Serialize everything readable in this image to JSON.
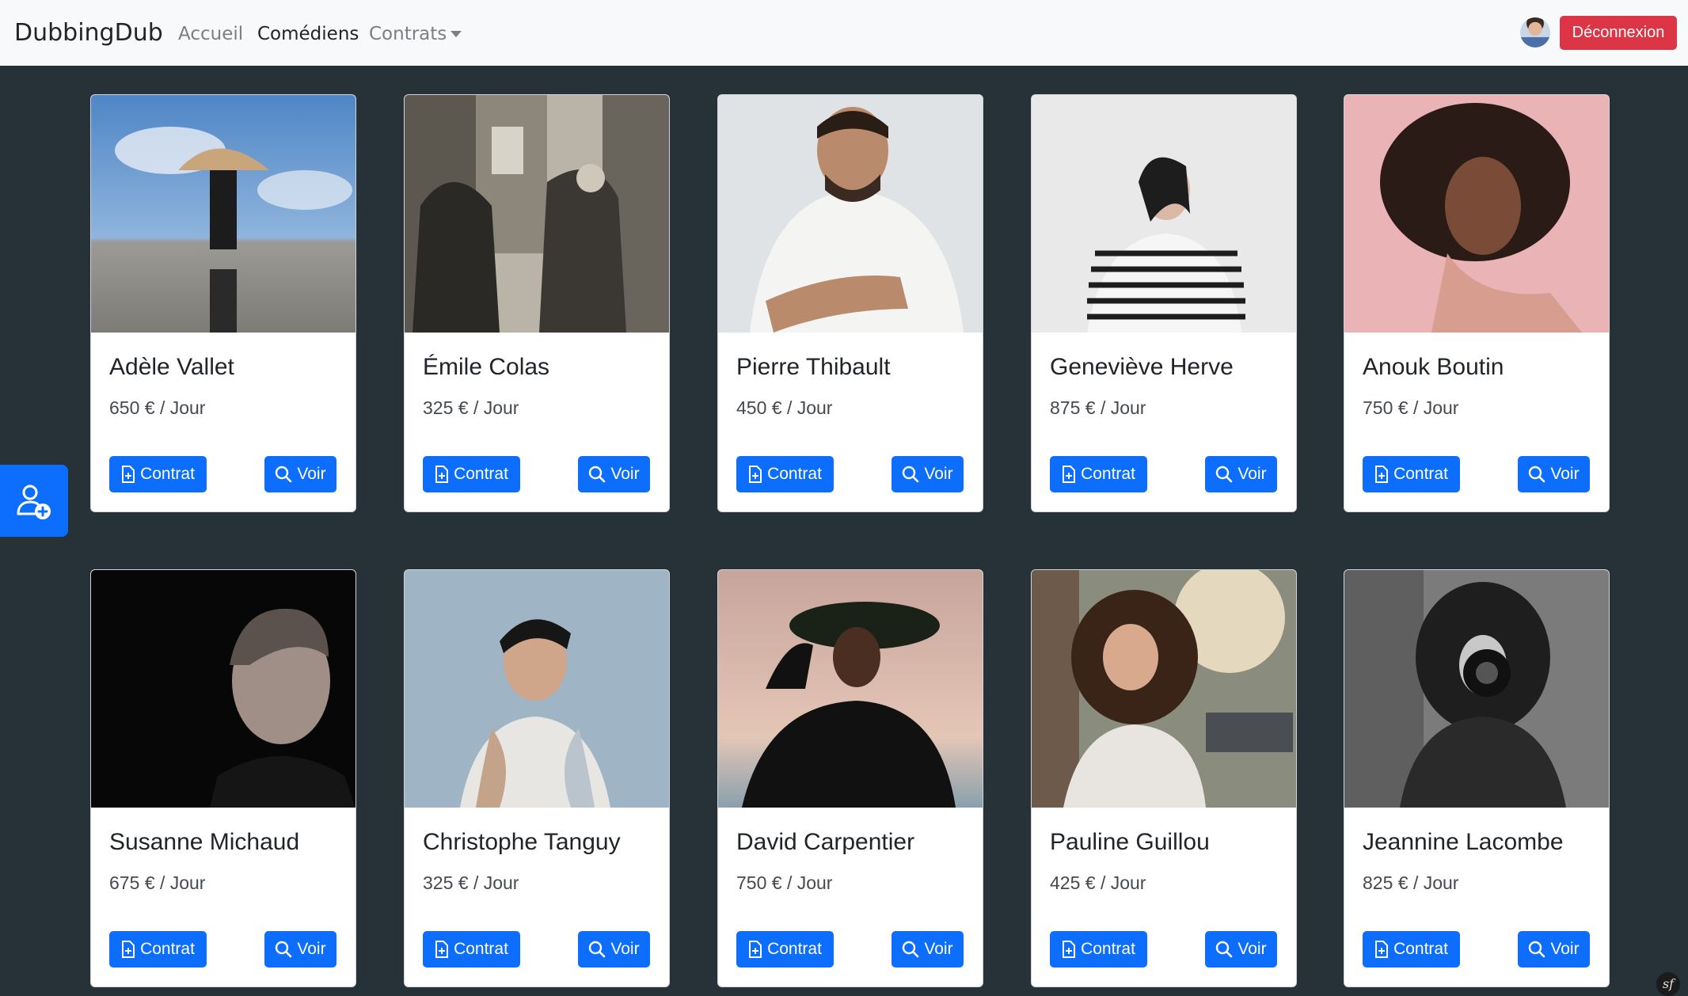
{
  "navbar": {
    "brand": "DubbingDub",
    "links": [
      {
        "label": "Accueil",
        "active": false
      },
      {
        "label": "Comédiens",
        "active": true
      },
      {
        "label": "Contrats",
        "active": false,
        "dropdown": true
      }
    ],
    "logout_label": "Déconnexion",
    "logout_color": "#dc3545"
  },
  "fab": {
    "icon": "user-add-icon"
  },
  "buttons": {
    "contract_label": "Contrat",
    "contract_icon": "file-plus-icon",
    "view_label": "Voir",
    "view_icon": "search-icon",
    "color": "#0d6efd"
  },
  "actors": [
    {
      "name": "Adèle Vallet",
      "price": "650 € / Jour"
    },
    {
      "name": "Émile Colas",
      "price": "325 € / Jour"
    },
    {
      "name": "Pierre Thibault",
      "price": "450 € / Jour"
    },
    {
      "name": "Geneviève Herve",
      "price": "875 € / Jour"
    },
    {
      "name": "Anouk Boutin",
      "price": "750 € / Jour"
    },
    {
      "name": "Susanne Michaud",
      "price": "675 € / Jour"
    },
    {
      "name": "Christophe Tanguy",
      "price": "325 € / Jour"
    },
    {
      "name": "David Carpentier",
      "price": "750 € / Jour"
    },
    {
      "name": "Pauline Guillou",
      "price": "425 € / Jour"
    },
    {
      "name": "Jeannine Lacombe",
      "price": "825 € / Jour"
    }
  ],
  "background_color": "#263238"
}
